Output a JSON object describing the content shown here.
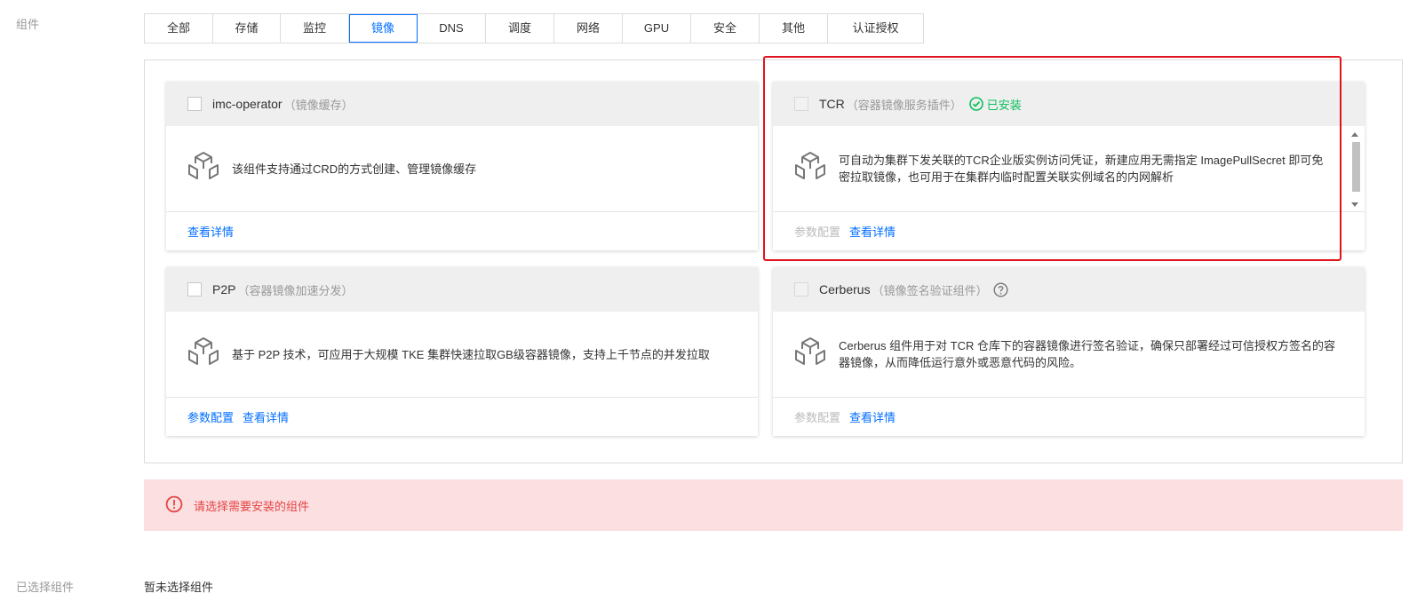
{
  "labels": {
    "components": "组件",
    "selected_components": "已选择组件"
  },
  "tabs": [
    {
      "label": "全部",
      "active": false
    },
    {
      "label": "存储",
      "active": false
    },
    {
      "label": "监控",
      "active": false
    },
    {
      "label": "镜像",
      "active": true
    },
    {
      "label": "DNS",
      "active": false
    },
    {
      "label": "调度",
      "active": false
    },
    {
      "label": "网络",
      "active": false
    },
    {
      "label": "GPU",
      "active": false
    },
    {
      "label": "安全",
      "active": false
    },
    {
      "label": "其他",
      "active": false
    },
    {
      "label": "认证授权",
      "active": false
    }
  ],
  "cards": [
    {
      "name": "imc-operator",
      "alias": "（镜像缓存）",
      "description": "该组件支持通过CRD的方式创建、管理镜像缓存",
      "details_link": "查看详情"
    },
    {
      "name": "TCR",
      "alias": "（容器镜像服务插件）",
      "status": "已安装",
      "description": "可自动为集群下发关联的TCR企业版实例访问凭证，新建应用无需指定 ImagePullSecret 即可免密拉取镜像，也可用于在集群内临时配置关联实例域名的内网解析",
      "config_link": "参数配置",
      "details_link": "查看详情"
    },
    {
      "name": "P2P",
      "alias": "（容器镜像加速分发）",
      "description": "基于 P2P 技术，可应用于大规模 TKE 集群快速拉取GB级容器镜像，支持上千节点的并发拉取",
      "config_link": "参数配置",
      "details_link": "查看详情"
    },
    {
      "name": "Cerberus",
      "alias": "（镜像签名验证组件）",
      "description": "Cerberus 组件用于对 TCR 仓库下的容器镜像进行签名验证，确保只部署经过可信授权方签名的容器镜像，从而降低运行意外或恶意代码的风险。",
      "config_link": "参数配置",
      "details_link": "查看详情"
    }
  ],
  "alert": {
    "message": "请选择需要安装的组件"
  },
  "selected": {
    "empty_text": "暂未选择组件"
  },
  "colors": {
    "accent": "#006eff",
    "success": "#0abf5b",
    "error": "#e54545",
    "highlight": "#e0141e"
  }
}
